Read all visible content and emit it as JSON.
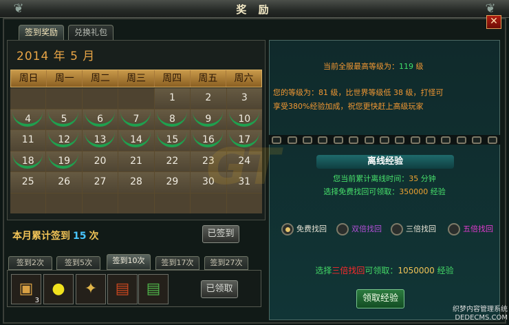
{
  "window": {
    "title": "奖 励",
    "close_label": "✕"
  },
  "tabs": [
    {
      "label": "签到奖励",
      "active": true
    },
    {
      "label": "兑换礼包",
      "active": false
    }
  ],
  "calendar": {
    "year_month": "2014 年 5 月",
    "weekdays": [
      "周日",
      "周一",
      "周二",
      "周三",
      "周四",
      "周五",
      "周六"
    ],
    "cells": [
      "",
      "",
      "",
      "",
      "1",
      "2",
      "3",
      "4",
      "5",
      "6",
      "7",
      "8",
      "9",
      "10",
      "11",
      "12",
      "13",
      "14",
      "15",
      "16",
      "17",
      "18",
      "19",
      "20",
      "21",
      "22",
      "23",
      "24",
      "25",
      "26",
      "27",
      "28",
      "29",
      "30",
      "31",
      "",
      "",
      "",
      "",
      "",
      "",
      ""
    ],
    "signed_days": [
      "4",
      "5",
      "6",
      "7",
      "8",
      "9",
      "10",
      "12",
      "13",
      "14",
      "15",
      "16",
      "17",
      "18",
      "19"
    ]
  },
  "sign_summary": {
    "prefix": "本月累计签到",
    "count": "15",
    "suffix": "次"
  },
  "signed_button": "已签到",
  "milestone_tabs": [
    "签到2次",
    "签到5次",
    "签到10次",
    "签到17次",
    "签到27次"
  ],
  "milestone_active_index": 2,
  "reward_items": [
    {
      "icon": "treasure-chest-icon",
      "glyph": "▣",
      "qty": "3"
    },
    {
      "icon": "gold-coin-icon",
      "glyph": "●",
      "qty": ""
    },
    {
      "icon": "crystal-icon",
      "glyph": "✦",
      "qty": ""
    },
    {
      "icon": "red-book-icon",
      "glyph": "▤",
      "qty": ""
    },
    {
      "icon": "green-book-icon",
      "glyph": "▤",
      "qty": ""
    }
  ],
  "claimed_button": "已领取",
  "server_info": {
    "max_level_prefix": "当前全服最高等级为：",
    "max_level": "119",
    "max_level_suffix": "级",
    "your_level_line1": "您的等级为：81 级，比世界等级低 38 级，打怪可",
    "your_level_line2": "享受380%经验加成，祝您更快赶上高级玩家"
  },
  "offline": {
    "title": "离线经验",
    "time_prefix": "您当前累计离线时间：",
    "time_value": "35",
    "time_unit": "分钟",
    "free_prefix": "选择",
    "free_label": "免费找回",
    "free_mid": "可领取：",
    "free_value": "350000",
    "free_unit": "经验"
  },
  "recover_options": [
    {
      "label": "免费找回",
      "selected": true,
      "color": "#e8e4d6"
    },
    {
      "label": "双倍找回",
      "selected": false,
      "color": "#b24fd7"
    },
    {
      "label": "三倍找回",
      "selected": false,
      "color": "#e8e4d6"
    },
    {
      "label": "五倍找回",
      "selected": false,
      "color": "#e23bcf"
    }
  ],
  "selection": {
    "prefix": "选择",
    "option": "三倍找回",
    "mid": "可领取：",
    "value": "1050000",
    "unit": "经验"
  },
  "receive_button": "领取经验",
  "watermark": {
    "line1": "织梦内容管理系统",
    "line2": "DEDECMS.COM"
  }
}
